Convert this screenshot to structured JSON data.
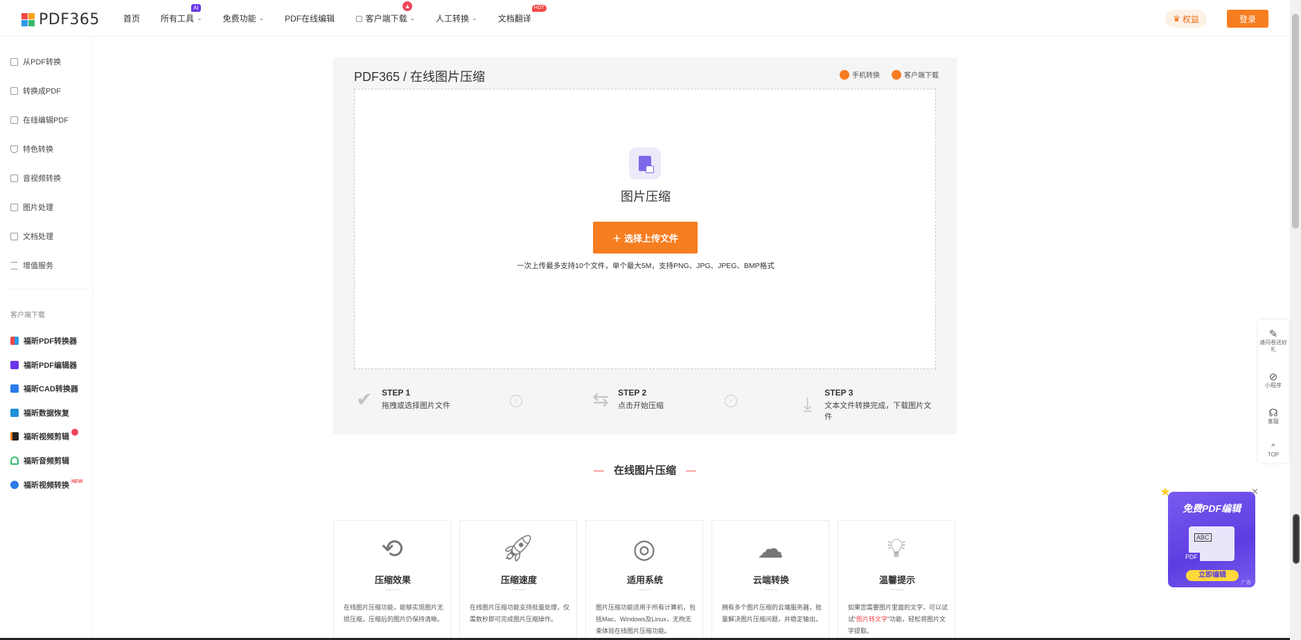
{
  "header": {
    "logo_text": "PDF365",
    "nav": [
      {
        "label": "首页"
      },
      {
        "label": "所有工具",
        "badge": "AI"
      },
      {
        "label": "免费功能"
      },
      {
        "label": "PDF在线编辑"
      },
      {
        "label": "客户端下载"
      },
      {
        "label": "人工转换"
      },
      {
        "label": "文档翻译",
        "badge": "HOT"
      }
    ],
    "rights_label": "权益",
    "login_label": "登录"
  },
  "sidebar": {
    "items": [
      {
        "label": "从PDF转换"
      },
      {
        "label": "转换成PDF"
      },
      {
        "label": "在线编辑PDF"
      },
      {
        "label": "特色转换"
      },
      {
        "label": "音视频转换"
      },
      {
        "label": "图片处理"
      },
      {
        "label": "文档处理"
      },
      {
        "label": "增值服务"
      }
    ],
    "section_label": "客户端下载",
    "apps": [
      {
        "label": "福昕PDF转换器"
      },
      {
        "label": "福昕PDF编辑器"
      },
      {
        "label": "福昕CAD转换器"
      },
      {
        "label": "福昕数据恢复"
      },
      {
        "label": "福昕视频剪辑"
      },
      {
        "label": "福昕音频剪辑"
      },
      {
        "label": "福昕视频转换",
        "badge": "NEW"
      }
    ]
  },
  "panel": {
    "title": "PDF365 / 在线图片压缩",
    "mobile_link": "手机转换",
    "client_link": "客户端下载",
    "tool_title": "图片压缩",
    "upload_label": "选择上传文件",
    "hint": "一次上传最多支持10个文件，单个最大5M，支持PNG、JPG、JPEG、BMP格式",
    "steps": [
      {
        "title": "STEP 1",
        "desc": "拖拽或选择图片文件"
      },
      {
        "title": "STEP 2",
        "desc": "点击开始压缩"
      },
      {
        "title": "STEP 3",
        "desc": "文本文件转换完成，下载图片文件"
      }
    ]
  },
  "section_title": "在线图片压缩",
  "cards": [
    {
      "title": "压缩效果",
      "text": "在线图片压缩功能，能够实现图片无损压缩，压缩后的图片仍保持清晰。"
    },
    {
      "title": "压缩速度",
      "text": "在线图片压缩功能支持批量处理，仅需数秒即可完成图片压缩操作。"
    },
    {
      "title": "适用系统",
      "text": "图片压缩功能适用于所有计算机，包括Mac、Windows及Linux，无拘无束体验在线图片压缩功能。"
    },
    {
      "title": "云端转换",
      "text": "拥有多个图片压缩的云端服务器，批量解决图片压缩问题，并稳定输出。"
    },
    {
      "title": "温馨提示",
      "text_pre": "如果您需要图片里面的文字，可以试试“",
      "text_link": "图片转文字",
      "text_post": "”功能，轻松将图片文字提取。"
    }
  ],
  "float_bar": [
    {
      "label": "请问卷送好礼",
      "icon": "survey-icon"
    },
    {
      "label": "小程序",
      "icon": "mini-program-icon"
    },
    {
      "label": "客服",
      "icon": "headset-icon"
    },
    {
      "label": "TOP",
      "icon": "arrow-up-icon"
    }
  ],
  "ad": {
    "title": "免费PDF编辑",
    "screen_text": "ABC",
    "pdf_tag": "PDF",
    "button": "立即编辑",
    "tag": "广告"
  }
}
